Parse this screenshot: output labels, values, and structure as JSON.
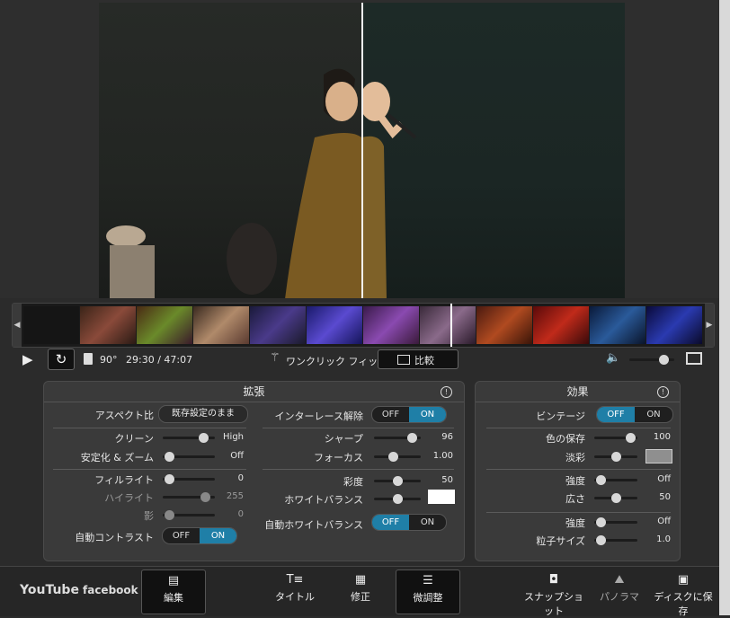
{
  "controls": {
    "rotate_label": "90°",
    "timecode": "29:30 / 47:07",
    "one_click_fix": "ワンクリック フィックス",
    "compare": "比較"
  },
  "expand_panel": {
    "title": "拡張",
    "aspect_label": "アスペクト比",
    "aspect_value": "既存設定のまま",
    "clean_label": "クリーン",
    "clean_value": "High",
    "stabilize_label": "安定化 & ズーム",
    "stabilize_value": "Off",
    "filllight_label": "フィルライト",
    "filllight_value": "0",
    "highlight_label": "ハイライト",
    "highlight_value": "255",
    "shadow_label": "影",
    "shadow_value": "0",
    "autocontrast_label": "自動コントラスト",
    "deinterlace_label": "インターレース解除",
    "sharp_label": "シャープ",
    "sharp_value": "96",
    "focus_label": "フォーカス",
    "focus_value": "1.00",
    "saturation_label": "彩度",
    "saturation_value": "50",
    "whitebalance_label": "ホワイトバランス",
    "autowb_label": "自動ホワイトバランス",
    "off": "OFF",
    "on": "ON"
  },
  "effects_panel": {
    "title": "効果",
    "vintage_label": "ビンテージ",
    "color_keep_label": "色の保存",
    "color_keep_value": "100",
    "tint_label": "淡彩",
    "intensity1_label": "強度",
    "intensity1_value": "Off",
    "width_label": "広さ",
    "width_value": "50",
    "intensity2_label": "強度",
    "intensity2_value": "Off",
    "grain_label": "粒子サイズ",
    "grain_value": "1.0",
    "off": "OFF",
    "on": "ON"
  },
  "bottom_bar": {
    "youtube": "YouTube",
    "facebook": "facebook",
    "edit": "編集",
    "title": "タイトル",
    "fix": "修正",
    "tune": "微調整",
    "snapshot": "スナップショット",
    "panorama": "パノラマ",
    "save_disc": "ディスクに保存"
  },
  "levels": {
    "clean": 0.85,
    "stabilize": 0.05,
    "filllight": 0.05,
    "highlight": 0.9,
    "shadow": 0.05,
    "sharp": 0.9,
    "focus": 0.4,
    "saturation": 0.5,
    "wb": 0.5,
    "color_keep": 0.95,
    "tint": 0.5,
    "intensity1": 0.05,
    "width": 0.5,
    "intensity2": 0.05,
    "grain": 0.05,
    "volume": 0.85
  },
  "colors": {
    "accent": "#1f7fa7",
    "panel": "#3a3a3a",
    "background": "#2b2b2b"
  }
}
